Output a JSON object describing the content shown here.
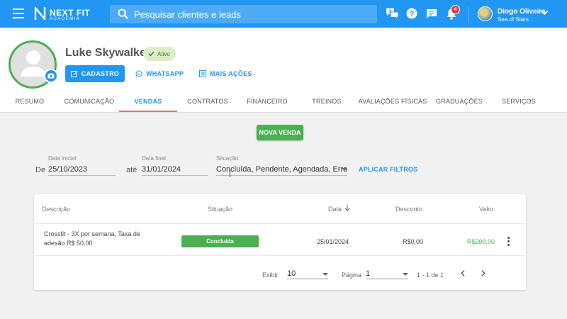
{
  "topbar": {
    "brand": "NEXT FIT",
    "brand_sub": "ACADEMIA",
    "search_placeholder": "Pesquisar clientes e leads",
    "notification_count": "4",
    "user_name": "Diogo Oliveira",
    "user_subtitle": "Sea of Stars",
    "accent_color": "#2196f3",
    "icons": [
      "menu-icon",
      "chat-bubbles-icon",
      "help-icon",
      "message-icon",
      "bell-icon",
      "chevron-down-icon"
    ]
  },
  "profile": {
    "name": "Luke Skywalker",
    "status": "Ativo",
    "actions": {
      "cadastro": "CADASTRO",
      "whatsapp": "WHATSAPP",
      "mais_acoes": "MAIS AÇÕES"
    }
  },
  "tabs": [
    {
      "label": "RESUMO"
    },
    {
      "label": "COMUNICAÇÃO"
    },
    {
      "label": "VENDAS",
      "active": true
    },
    {
      "label": "CONTRATOS"
    },
    {
      "label": "FINANCEIRO"
    },
    {
      "label": "TREINOS"
    },
    {
      "label": "AVALIAÇÕES FÍSICAS"
    },
    {
      "label": "GRADUAÇÕES"
    },
    {
      "label": "SERVIÇOS"
    }
  ],
  "sales": {
    "new_sale_label": "NOVA VENDA",
    "filters": {
      "de_label": "De",
      "ate_label": "até",
      "start_label": "Data inicial",
      "start_value": "25/10/2023",
      "end_label": "Data final",
      "end_value": "31/01/2024",
      "status_label": "Situação",
      "status_value": "Concluída, Pendente, Agendada, Erro",
      "apply_label": "APLICAR FILTROS"
    },
    "table": {
      "columns": [
        "Descrição",
        "Situação",
        "Data",
        "Desconto",
        "Valor"
      ],
      "rows": [
        {
          "descricao": "Crossfit - 3X por semana, Taxa de adesão R$ 50,00",
          "situacao": "Concluída",
          "data": "25/01/2024",
          "desconto": "R$0,00",
          "valor": "R$200,00"
        }
      ]
    },
    "pagination": {
      "exibir_label": "Exibir",
      "exibir_value": "10",
      "pagina_label": "Página",
      "pagina_value": "1",
      "range": "1 - 1 de 1"
    }
  }
}
